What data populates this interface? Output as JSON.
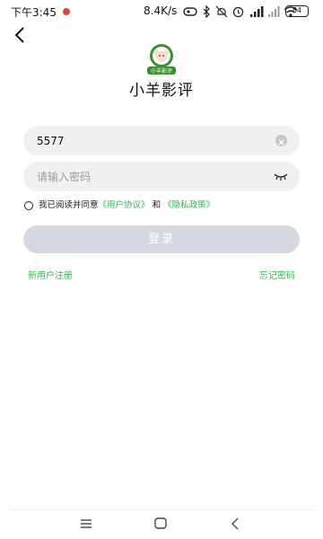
{
  "status_bar": {
    "time": "下午3:45",
    "network_speed": "8.4K/s",
    "battery": "84",
    "icons": [
      "hd-icon",
      "bluetooth-icon",
      "mute-icon",
      "alarm-icon",
      "signal-icon",
      "signal2-icon",
      "wifi-icon"
    ]
  },
  "app": {
    "logo_text": "小羊影评",
    "title": "小羊影评"
  },
  "form": {
    "account_value": "5577",
    "password_placeholder": "请输入密码"
  },
  "agreement": {
    "prefix": "我已阅读并同意",
    "user_agreement": "《用户协议》",
    "conjunction": "和",
    "privacy_policy": "《隐私政策》",
    "checked": false
  },
  "login_label": "登录",
  "register_label": "新用户注册",
  "forgot_label": "忘记密码",
  "colors": {
    "accent": "#2fb84a",
    "button_disabled": "#d5d8de",
    "field_bg": "#f0f0f2",
    "logo_green": "#3c8f2e"
  }
}
